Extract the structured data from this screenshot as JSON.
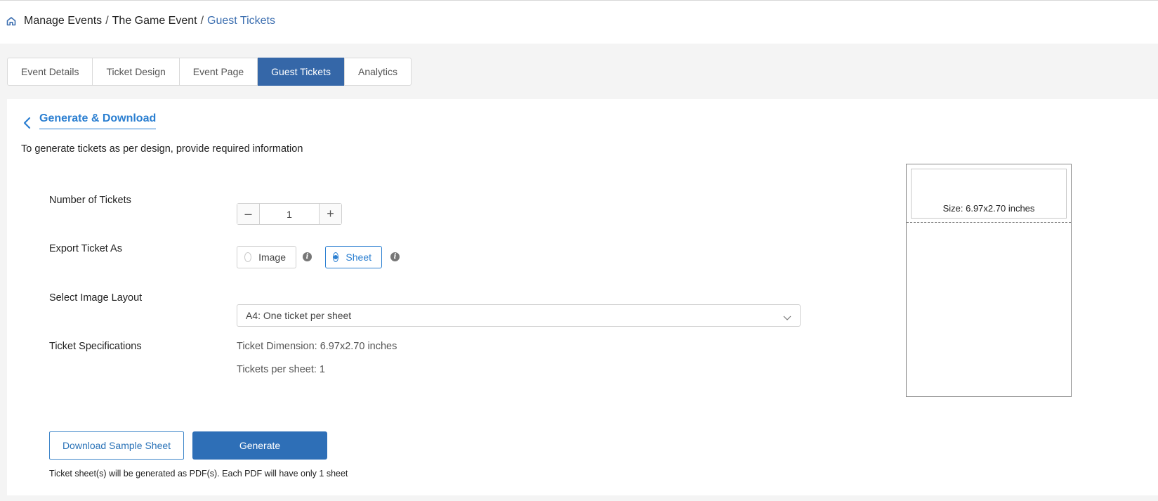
{
  "breadcrumb": {
    "items": [
      "Manage Events",
      "The Game Event"
    ],
    "separator": "/",
    "current": "Guest Tickets"
  },
  "tabs": [
    {
      "label": "Event Details",
      "active": false
    },
    {
      "label": "Ticket Design",
      "active": false
    },
    {
      "label": "Event Page",
      "active": false
    },
    {
      "label": "Guest Tickets",
      "active": true
    },
    {
      "label": "Analytics",
      "active": false
    }
  ],
  "section": {
    "title": "Generate & Download",
    "intro": "To generate tickets as per design, provide required information"
  },
  "form": {
    "num_tickets_label": "Number of Tickets",
    "num_tickets_value": "1",
    "minus_symbol": "–",
    "plus_symbol": "+",
    "export_label": "Export Ticket As",
    "export_options": [
      {
        "label": "Image",
        "selected": false
      },
      {
        "label": "Sheet",
        "selected": true
      }
    ],
    "info_symbol": "i",
    "layout_label": "Select Image Layout",
    "layout_value": "A4: One ticket per sheet",
    "spec_label": "Ticket Specifications",
    "spec_dimension": "Ticket Dimension: 6.97x2.70 inches",
    "spec_per_sheet": "Tickets per sheet: 1"
  },
  "actions": {
    "download_sample": "Download Sample Sheet",
    "generate": "Generate",
    "note": "Ticket sheet(s) will be generated as PDF(s). Each PDF will have only 1 sheet"
  },
  "preview": {
    "size_text": "Size: 6.97x2.70 inches"
  },
  "colors": {
    "accent": "#2b7fd1",
    "tab_active": "#3567a8",
    "primary_button": "#2e6fb7",
    "breadcrumb_current": "#3d6fb0"
  },
  "icons": {
    "home": "home-icon",
    "back": "chevron-left-icon",
    "dropdown": "chevron-down-icon",
    "info": "info-icon"
  }
}
